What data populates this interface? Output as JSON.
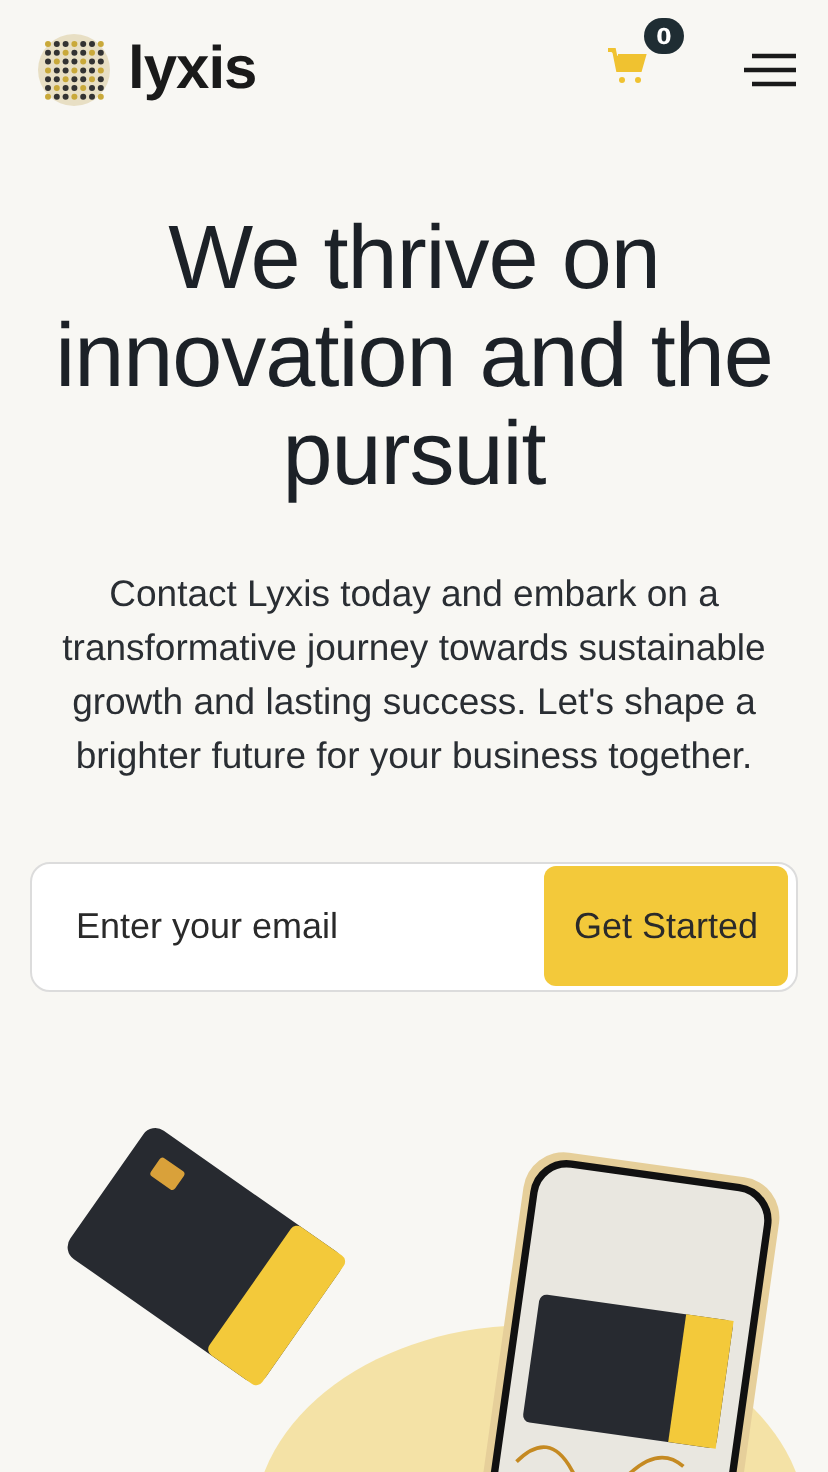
{
  "header": {
    "brand": "lyxis",
    "cart_count": "0"
  },
  "hero": {
    "title": "We thrive on innovation and the pursuit",
    "text": "Contact Lyxis today and embark on a transformative journey towards sustainable growth and lasting success. Let's shape a brighter future for your business together."
  },
  "signup": {
    "placeholder": "Enter your email",
    "button": "Get Started"
  }
}
